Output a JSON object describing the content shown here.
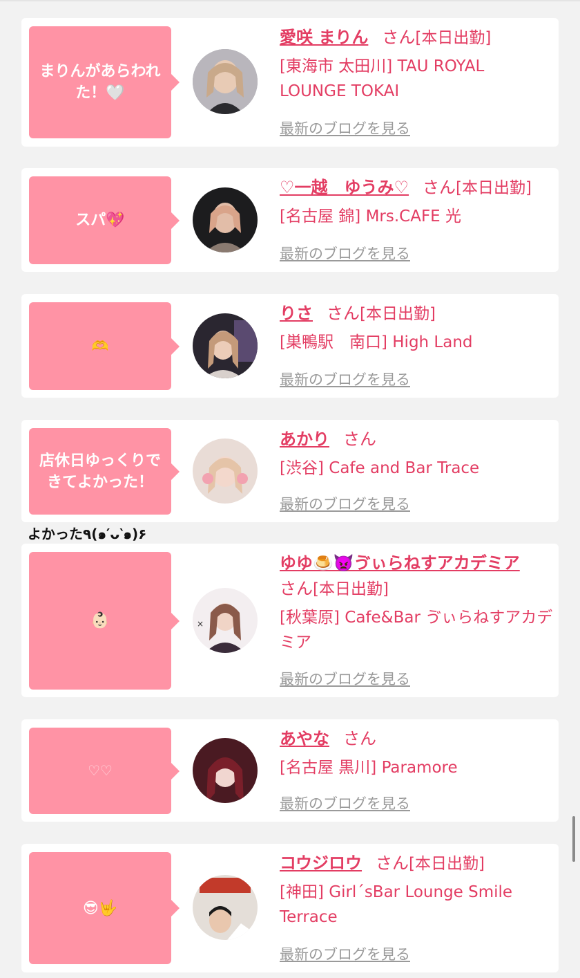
{
  "overlay_text": "よかった٩(๑′ᴗ‵๑)۶",
  "blog_link_label": "最新のブログを見る",
  "san_label": "さん",
  "accent_color": "#e33d63",
  "bubble_color": "#ff93a5",
  "cards": [
    {
      "message": "まりんがあらわれた！🤍",
      "name": "愛咲 まりん",
      "status": "[本日出勤]",
      "shop": "[東海市 太田川] TAU ROYAL LOUNGE TOKAI"
    },
    {
      "message": "スパ💖",
      "name": "♡一越　ゆうみ♡",
      "status": "[本日出勤]",
      "shop": "[名古屋 錦] Mrs.CAFE 光"
    },
    {
      "message": "🫶",
      "name": "りさ",
      "status": "[本日出勤]",
      "shop": "[巣鴨駅　南口] High Land"
    },
    {
      "message": "店休日ゆっくりできてよかった！",
      "name": "あかり",
      "status": "",
      "shop": "[渋谷] Cafe and Bar Trace"
    },
    {
      "message": "👶🏻",
      "name": "ゆゆ🍮👿ゔぃらねすアカデミア",
      "status": "[本日出勤]",
      "shop": "[秋葉原] Cafe&Bar ゔぃらねすアカデミア"
    },
    {
      "message": "♡♡",
      "name": "あやな",
      "status": "",
      "shop": "[名古屋 黒川] Paramore"
    },
    {
      "message": "😎🤟",
      "name": "コウジロウ",
      "status": "[本日出勤]",
      "shop": "[神田] Girl´sBar Lounge Smile Terrace"
    }
  ]
}
